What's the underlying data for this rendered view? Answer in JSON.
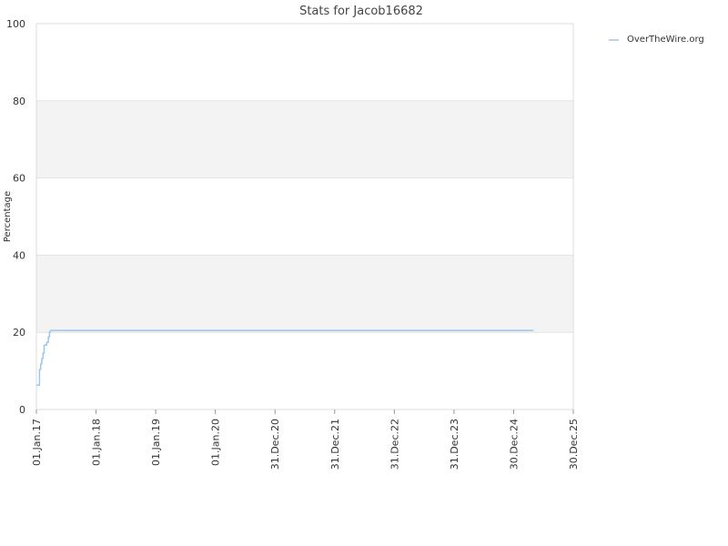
{
  "chart_data": {
    "type": "line",
    "title": "Stats for Jacob16682",
    "ylabel": "Percentage",
    "xlabel": "",
    "ylim": [
      0,
      100
    ],
    "yticks": [
      0,
      20,
      40,
      60,
      80,
      100
    ],
    "xlim": [
      "2017-01-01",
      "2025-12-30"
    ],
    "xticks": [
      {
        "label": "01.Jan.17",
        "date": "2017-01-01"
      },
      {
        "label": "01.Jan.18",
        "date": "2018-01-01"
      },
      {
        "label": "01.Jan.19",
        "date": "2019-01-01"
      },
      {
        "label": "01.Jan.20",
        "date": "2020-01-01"
      },
      {
        "label": "31.Dec.20",
        "date": "2020-12-31"
      },
      {
        "label": "31.Dec.21",
        "date": "2021-12-31"
      },
      {
        "label": "31.Dec.22",
        "date": "2022-12-31"
      },
      {
        "label": "31.Dec.23",
        "date": "2023-12-31"
      },
      {
        "label": "30.Dec.24",
        "date": "2024-12-30"
      },
      {
        "label": "30.Dec.25",
        "date": "2025-12-30"
      }
    ],
    "grid": true,
    "legend_position": "top-right",
    "series": [
      {
        "name": "OverTheWire.org",
        "color": "#9fc5e8",
        "step": true,
        "points": [
          {
            "x": "2017-01-01",
            "y": 6.3
          },
          {
            "x": "2017-01-19",
            "y": 6.3
          },
          {
            "x": "2017-01-20",
            "y": 10.4
          },
          {
            "x": "2017-01-27",
            "y": 11.8
          },
          {
            "x": "2017-02-03",
            "y": 13.2
          },
          {
            "x": "2017-02-10",
            "y": 14.6
          },
          {
            "x": "2017-02-17",
            "y": 16.7
          },
          {
            "x": "2017-03-05",
            "y": 17.4
          },
          {
            "x": "2017-03-15",
            "y": 18.8
          },
          {
            "x": "2017-03-22",
            "y": 20.1
          },
          {
            "x": "2017-03-29",
            "y": 20.5
          },
          {
            "x": "2025-05-01",
            "y": 20.5
          }
        ]
      }
    ]
  }
}
